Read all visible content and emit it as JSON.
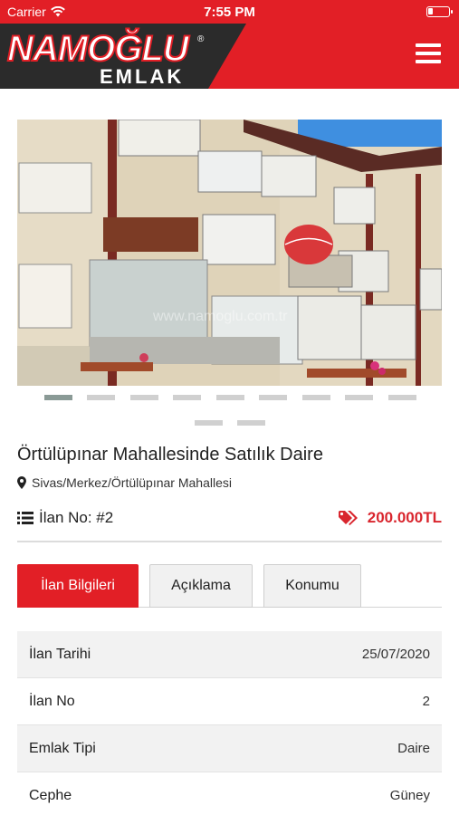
{
  "status": {
    "carrier": "Carrier",
    "time": "7:55 PM"
  },
  "header": {
    "logo_main": "NAMOĞLU",
    "logo_reg": "®",
    "logo_sub": "EMLAK",
    "menu_icon": "hamburger-icon"
  },
  "photo": {
    "watermark": "www.namoglu.com.tr"
  },
  "carousel": {
    "count": 11,
    "active_index": 0
  },
  "listing": {
    "title": "Örtülüpınar Mahallesinde Satılık Daire",
    "location": "Sivas/Merkez/Örtülüpınar Mahallesi",
    "listing_no": "İlan No: #2",
    "price": "200.000TL"
  },
  "tabs": [
    {
      "label": "İlan Bilgileri",
      "active": true
    },
    {
      "label": "Açıklama",
      "active": false
    },
    {
      "label": "Konumu",
      "active": false
    }
  ],
  "info_rows": [
    {
      "key": "İlan Tarihi",
      "value": "25/07/2020"
    },
    {
      "key": "İlan No",
      "value": "2"
    },
    {
      "key": "Emlak Tipi",
      "value": "Daire"
    },
    {
      "key": "Cephe",
      "value": "Güney"
    }
  ],
  "colors": {
    "brand_red": "#e21f26",
    "price_red": "#d9262e",
    "dark": "#2a2a2a"
  }
}
